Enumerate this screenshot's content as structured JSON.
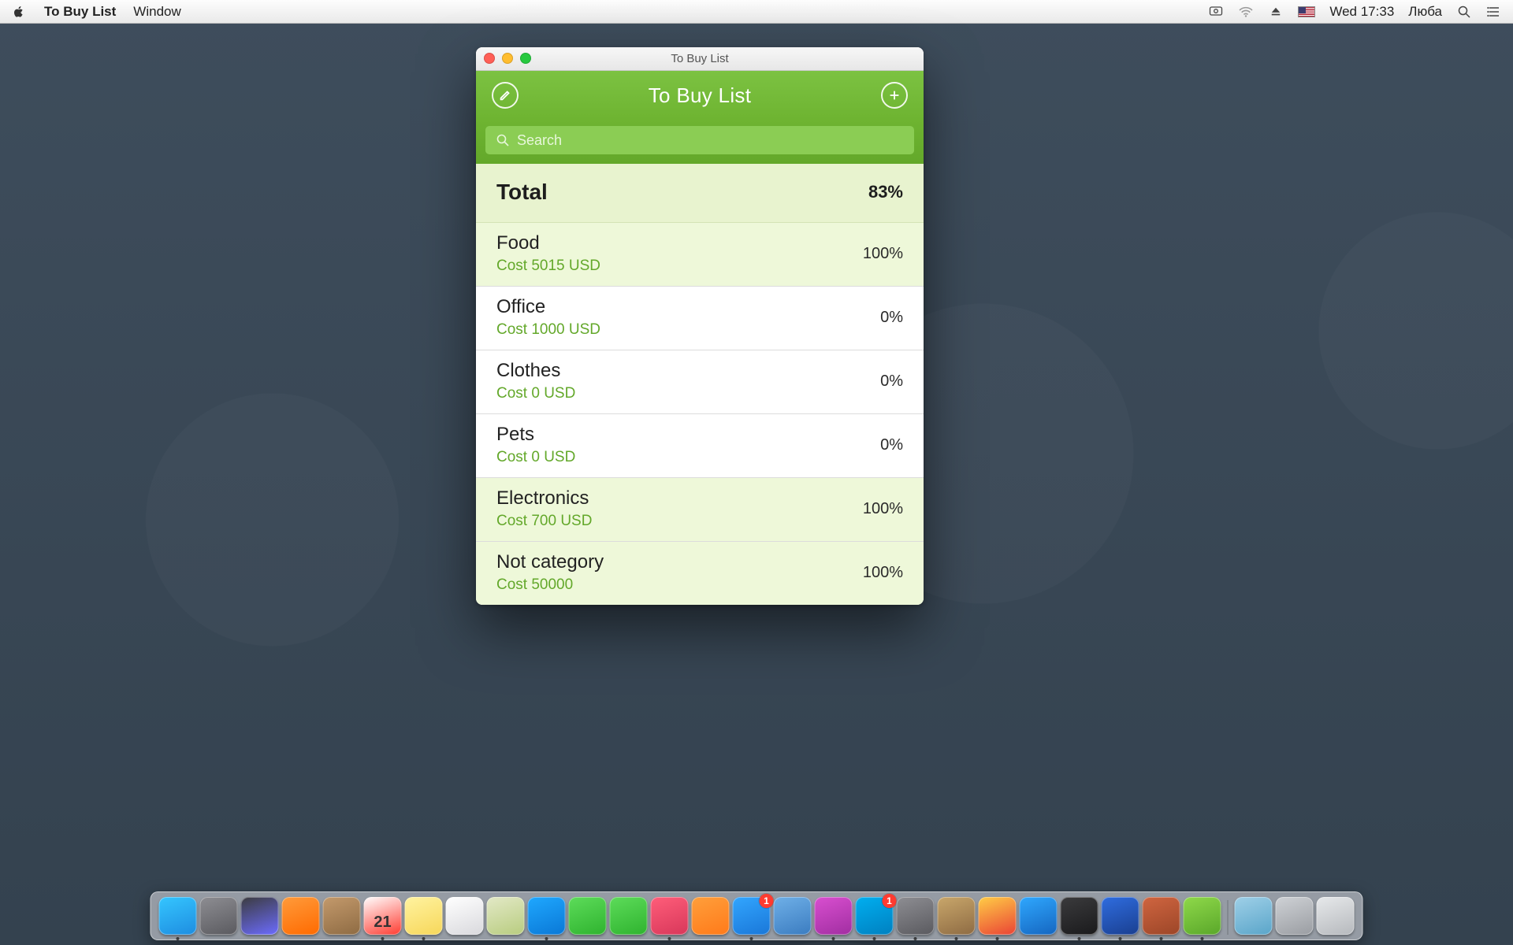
{
  "menubar": {
    "app_name": "To Buy List",
    "menus": [
      "Window"
    ],
    "clock": "Wed 17:33",
    "user": "Люба"
  },
  "window": {
    "title": "To Buy List",
    "header_title": "To Buy List",
    "search_placeholder": "Search",
    "total_label": "Total",
    "total_percent": "83%",
    "categories": [
      {
        "name": "Food",
        "cost": "Cost 5015 USD",
        "percent": "100%",
        "done": true
      },
      {
        "name": "Office",
        "cost": "Cost 1000 USD",
        "percent": "0%",
        "done": false
      },
      {
        "name": "Clothes",
        "cost": "Cost 0 USD",
        "percent": "0%",
        "done": false
      },
      {
        "name": "Pets",
        "cost": "Cost 0 USD",
        "percent": "0%",
        "done": false
      },
      {
        "name": "Electronics",
        "cost": "Cost 700 USD",
        "percent": "100%",
        "done": true
      },
      {
        "name": "Not category",
        "cost": "Cost 50000",
        "percent": "100%",
        "done": true
      }
    ]
  },
  "dock": {
    "apps": [
      {
        "name": "finder",
        "color1": "#35c6ff",
        "color2": "#1e8de0",
        "running": true
      },
      {
        "name": "launchpad",
        "color1": "#8e8e93",
        "color2": "#5a5a5f",
        "running": false
      },
      {
        "name": "mission-control",
        "color1": "#3b3b3d",
        "color2": "#6c6cff",
        "running": false
      },
      {
        "name": "photo-booth",
        "color1": "#ff9b3b",
        "color2": "#ff6a00",
        "running": false
      },
      {
        "name": "contacts",
        "color1": "#c49a6c",
        "color2": "#8e6b43",
        "running": false
      },
      {
        "name": "calendar",
        "color1": "#ffffff",
        "color2": "#ff3b30",
        "running": true,
        "text": "21"
      },
      {
        "name": "notes",
        "color1": "#fff3a0",
        "color2": "#f7d75a",
        "running": true
      },
      {
        "name": "reminders",
        "color1": "#ffffff",
        "color2": "#d9d9dd",
        "running": false
      },
      {
        "name": "maps",
        "color1": "#e3e9c7",
        "color2": "#b8cc7f",
        "running": false
      },
      {
        "name": "messages-blue",
        "color1": "#1fa8ff",
        "color2": "#0a78d6",
        "running": true
      },
      {
        "name": "messages-green",
        "color1": "#5ddc5a",
        "color2": "#2fb32f",
        "running": false
      },
      {
        "name": "facetime",
        "color1": "#5ddc5a",
        "color2": "#2fb32f",
        "running": false
      },
      {
        "name": "itunes",
        "color1": "#ff5e7a",
        "color2": "#d8375a",
        "running": true
      },
      {
        "name": "ibooks",
        "color1": "#ff9f3b",
        "color2": "#ff7a1a",
        "running": false
      },
      {
        "name": "appstore",
        "color1": "#32a6ff",
        "color2": "#1a77d8",
        "running": true,
        "badge": "1"
      },
      {
        "name": "preview",
        "color1": "#6fb0e8",
        "color2": "#3b7cc0",
        "running": false
      },
      {
        "name": "magnet",
        "color1": "#d94fd0",
        "color2": "#a12ea1",
        "running": true
      },
      {
        "name": "skype",
        "color1": "#00aff0",
        "color2": "#0080c0",
        "running": true,
        "badge": "1"
      },
      {
        "name": "photos",
        "color1": "#8e8e93",
        "color2": "#5a5a5f",
        "running": true
      },
      {
        "name": "mail",
        "color1": "#c9a76b",
        "color2": "#8e6b43",
        "running": true
      },
      {
        "name": "chrome",
        "color1": "#ffcd46",
        "color2": "#ea4335",
        "running": true
      },
      {
        "name": "safari",
        "color1": "#2fa8ff",
        "color2": "#1566c0",
        "running": false
      },
      {
        "name": "activity",
        "color1": "#3b3b3d",
        "color2": "#1a1a1c",
        "running": true
      },
      {
        "name": "thunderbird",
        "color1": "#2f6de0",
        "color2": "#1a3f90",
        "running": true
      },
      {
        "name": "transmission",
        "color1": "#d06540",
        "color2": "#9c4628",
        "running": true
      },
      {
        "name": "tobuylist",
        "color1": "#8fd94a",
        "color2": "#5aa72a",
        "running": true
      }
    ],
    "right": [
      {
        "name": "downloads",
        "color1": "#9fd0e8",
        "color2": "#5aa5c9"
      },
      {
        "name": "desktop-stack",
        "color1": "#cfd2d6",
        "color2": "#9a9da2"
      },
      {
        "name": "trash",
        "color1": "#e7e9eb",
        "color2": "#b6b9bd"
      }
    ]
  }
}
